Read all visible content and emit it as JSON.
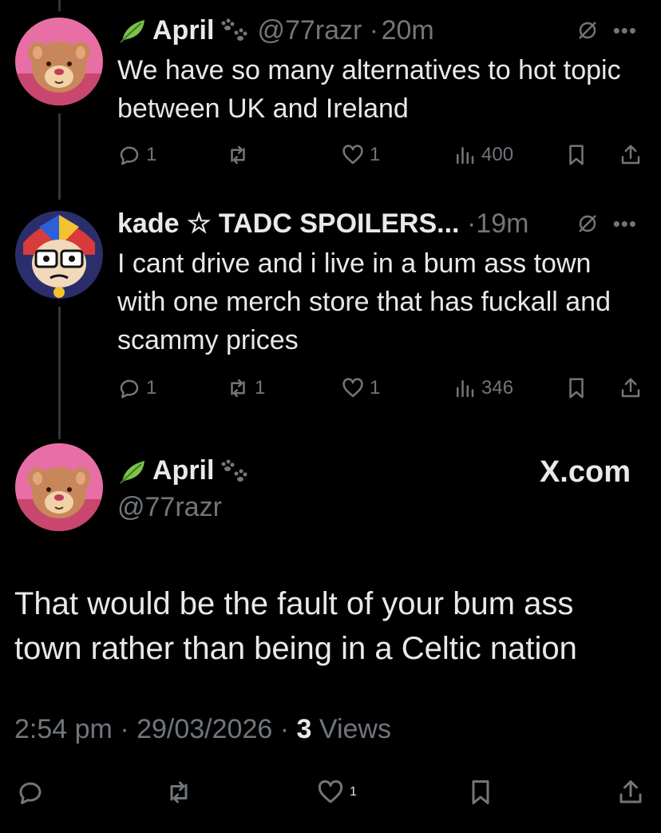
{
  "tweets": [
    {
      "display_name": "April",
      "handle": "@77razr",
      "time": "20m",
      "text": "We have so many alternatives to hot topic between UK and Ireland",
      "replies": "1",
      "reposts": "",
      "likes": "1",
      "views": "400"
    },
    {
      "display_name": "kade ☆ TADC SPOILERS...",
      "handle": "",
      "time": "19m",
      "text": "I cant drive and i live in a bum ass town with one merch store that has fuckall and scammy prices",
      "replies": "1",
      "reposts": "1",
      "likes": "1",
      "views": "346"
    }
  ],
  "main_tweet": {
    "display_name": "April",
    "handle": "@77razr",
    "watermark": "X.com",
    "text": "That would be the fault of your bum ass town rather than being in a Celtic nation",
    "time": "2:54 pm",
    "date": "29/03/2026",
    "views_count": "3",
    "views_label": "Views",
    "likes": "1"
  },
  "icons": {
    "reply": "reply-icon",
    "repost": "repost-icon",
    "like": "heart-icon",
    "views": "views-chart-icon",
    "bookmark": "bookmark-icon",
    "share": "share-icon",
    "grok": "grok-icon",
    "more": "more-icon"
  },
  "colors": {
    "background": "#000000",
    "text": "#e7e9ea",
    "muted": "#71767b",
    "leaf": "#7cc24a"
  }
}
